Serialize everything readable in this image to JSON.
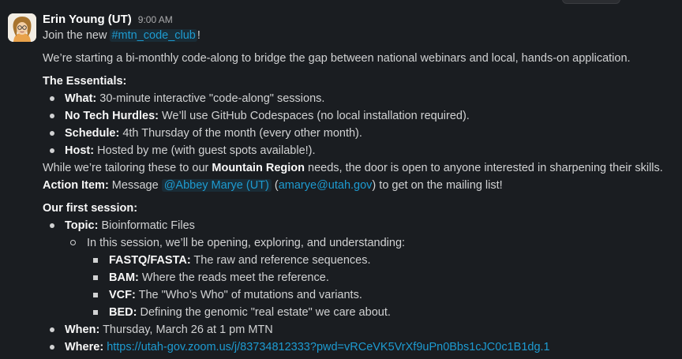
{
  "message": {
    "author": "Erin Young (UT)",
    "time": "9:00 AM",
    "intro": {
      "prefix": "Join the new ",
      "channel": "#mtn_code_club",
      "suffix": "!"
    },
    "description": "We’re starting a bi-monthly code-along to bridge the gap between national webinars and local, hands-on application.",
    "essentials_heading": "The Essentials:",
    "essentials": [
      {
        "label": "What:",
        "text": " 30-minute interactive \"code-along\" sessions."
      },
      {
        "label": "No Tech Hurdles:",
        "text": " We’ll use GitHub Codespaces (no local installation required)."
      },
      {
        "label": "Schedule:",
        "text": " 4th Thursday of the month (every other month)."
      },
      {
        "label": "Host:",
        "text": " Hosted by me (with guest spots available!)."
      }
    ],
    "region_line": {
      "prefix": "While we’re tailoring these to our ",
      "bold": "Mountain Region",
      "suffix": " needs, the door is open to anyone interested in sharpening their skills."
    },
    "action_item": {
      "label": "Action Item:",
      "prefix": " Message ",
      "mention": "@Abbey Marye (UT)",
      "paren_open": " (",
      "email": "amarye@utah.gov",
      "paren_close": ")",
      "suffix": " to get on the mailing list!"
    },
    "session_heading": "Our first session:",
    "topic": {
      "label": "Topic:",
      "text": " Bioinformatic Files"
    },
    "session_intro": "In this session, we’ll be opening, exploring, and understanding:",
    "file_types": [
      {
        "label": "FASTQ/FASTA:",
        "text": " The raw and reference sequences."
      },
      {
        "label": "BAM:",
        "text": " Where the reads meet the reference."
      },
      {
        "label": "VCF:",
        "text": " The \"Who’s Who\" of mutations and variants."
      },
      {
        "label": "BED:",
        "text": " Defining the genomic \"real estate\" we care about."
      }
    ],
    "when": {
      "label": "When:",
      "text": " Thursday, March 26 at 1 pm MTN"
    },
    "where": {
      "label": "Where:",
      "link": "https://utah-gov.zoom.us/j/83734812333?pwd=vRCeVK5VrXf9uPn0Bbs1cJC0c1B1dg.1"
    }
  },
  "colors": {
    "background": "#1a1d21",
    "text": "#d1d2d3",
    "link": "#1d9bd1"
  },
  "icons": {
    "avatar": "cartoon-portrait-avatar"
  }
}
